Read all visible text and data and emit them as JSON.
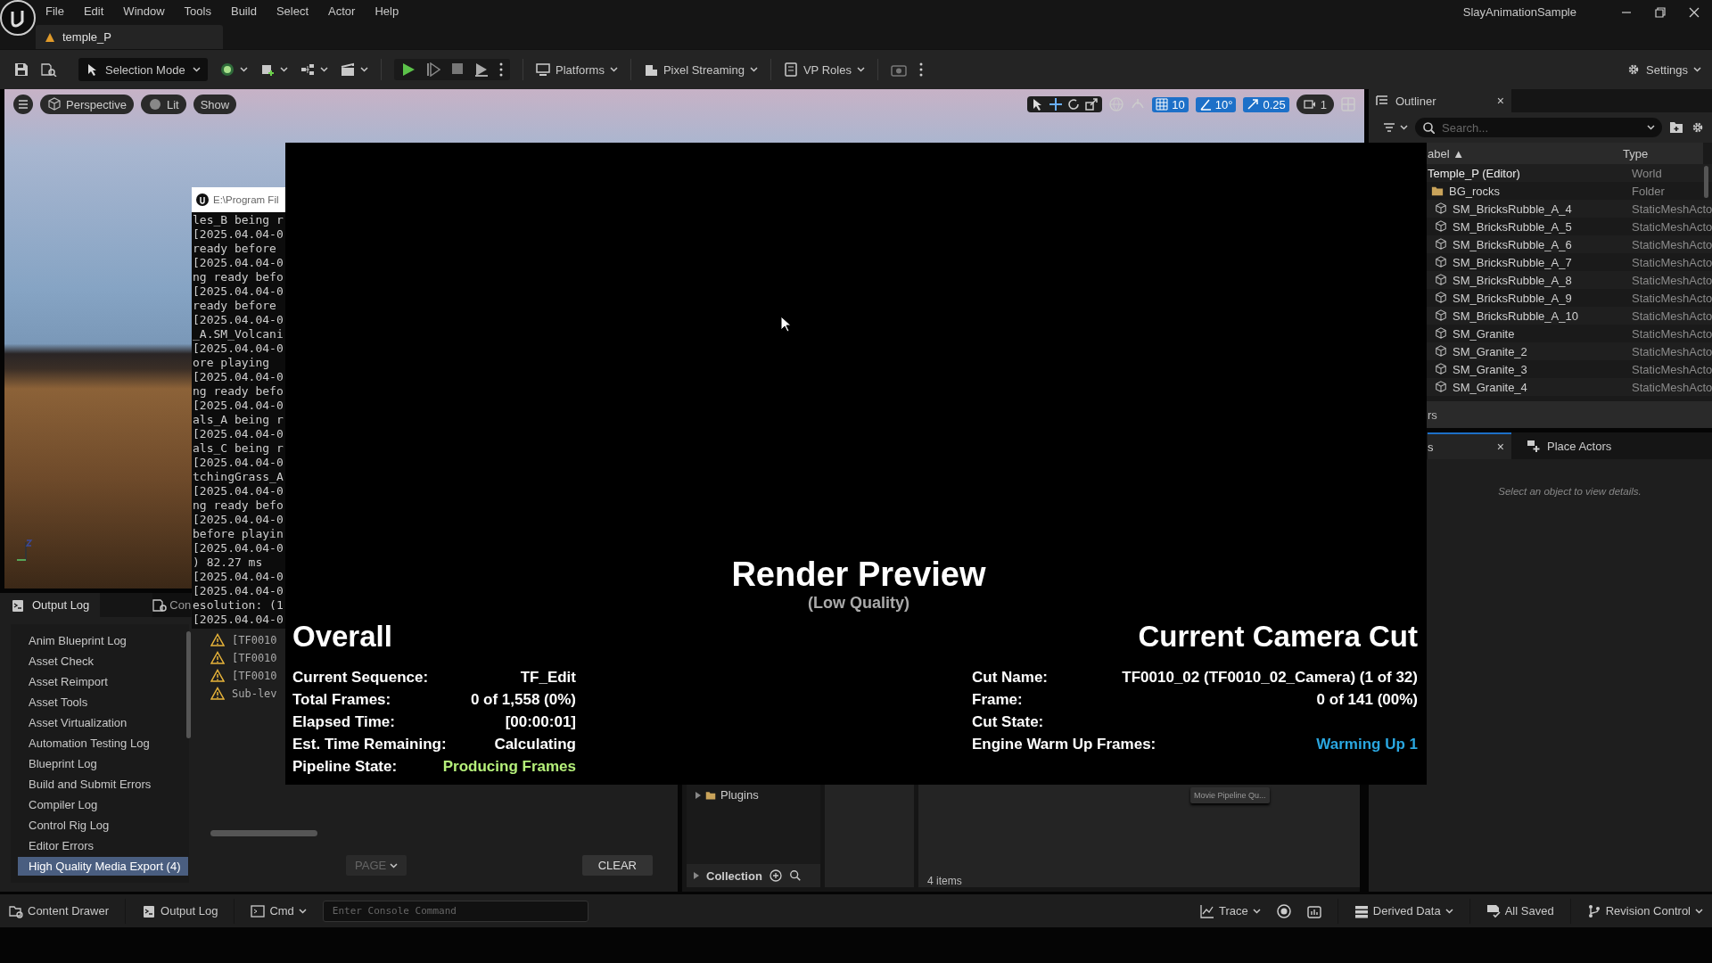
{
  "title_bar": {
    "menu": [
      "File",
      "Edit",
      "Window",
      "Tools",
      "Build",
      "Select",
      "Actor",
      "Help"
    ],
    "level_tab": "temple_P",
    "project": "SlayAnimationSample"
  },
  "toolbar": {
    "mode": "Selection Mode",
    "dropdowns": [
      "Platforms",
      "Pixel Streaming",
      "VP Roles"
    ],
    "settings": "Settings"
  },
  "viewport": {
    "view_buttons": [
      "Perspective",
      "Lit",
      "Show"
    ],
    "grid_snap": "10",
    "rotation_snap": "10°",
    "scale_snap": "0.25",
    "camera_speed": "1"
  },
  "console_window": {
    "title": "E:\\Program Fil",
    "lines": [
      "les_B being r",
      "[2025.04.04-0",
      "ready before",
      "[2025.04.04-0",
      "ng ready befo",
      "[2025.04.04-0",
      "ready before",
      "[2025.04.04-0",
      "_A.SM_Volcani",
      "[2025.04.04-0",
      "ore playing",
      "[2025.04.04-0",
      "ng ready befo",
      "[2025.04.04-0",
      "als_A being r",
      "[2025.04.04-0",
      "als_C being r",
      "[2025.04.04-0",
      "tchingGrass_A",
      "[2025.04.04-0",
      "ng ready befo",
      "[2025.04.04-0",
      "before playin",
      "[2025.04.04-0",
      ") 82.27 ms",
      "[2025.04.04-0",
      "[2025.04.04-0",
      "esolution: (1",
      "[2025.04.04-0"
    ]
  },
  "render_preview": {
    "title": "Render Preview",
    "subtitle": "(Low Quality)",
    "overall": {
      "heading": "Overall",
      "rows": [
        {
          "label": "Current Sequence:",
          "value": "TF_Edit"
        },
        {
          "label": "Total Frames:",
          "value": "0 of 1,558 (0%)"
        },
        {
          "label": "Elapsed Time:",
          "value": "[00:00:01]"
        },
        {
          "label": "Est. Time Remaining:",
          "value": "Calculating"
        },
        {
          "label": "Pipeline State:",
          "value": "Producing Frames",
          "color": "#b5f07a"
        }
      ]
    },
    "camera_cut": {
      "heading": "Current Camera Cut",
      "rows": [
        {
          "label": "Cut Name:",
          "value": "TF0010_02 (TF0010_02_Camera) (1 of 32)"
        },
        {
          "label": "Frame:",
          "value": "0 of 141 (00%)"
        },
        {
          "label": "Cut State:"
        },
        {
          "label": "Engine Warm Up Frames:",
          "value": "Warming Up 1",
          "color": "#2aa7e0"
        }
      ]
    }
  },
  "outliner": {
    "tab": "Outliner",
    "close": "×",
    "search_placeholder": "Search...",
    "columns": [
      "abel ▲",
      "Type"
    ],
    "tree": [
      {
        "label": "Temple_P (Editor)",
        "type": "World",
        "kind": "world",
        "children": [
          {
            "label": "BG_rocks",
            "type": "Folder",
            "kind": "folder",
            "children": [
              {
                "label": "SM_BricksRubble_A_4",
                "type": "StaticMeshActo",
                "kind": "mesh"
              },
              {
                "label": "SM_BricksRubble_A_5",
                "type": "StaticMeshActo",
                "kind": "mesh"
              },
              {
                "label": "SM_BricksRubble_A_6",
                "type": "StaticMeshActo",
                "kind": "mesh"
              },
              {
                "label": "SM_BricksRubble_A_7",
                "type": "StaticMeshActo",
                "kind": "mesh"
              },
              {
                "label": "SM_BricksRubble_A_8",
                "type": "StaticMeshActo",
                "kind": "mesh"
              },
              {
                "label": "SM_BricksRubble_A_9",
                "type": "StaticMeshActo",
                "kind": "mesh"
              },
              {
                "label": "SM_BricksRubble_A_10",
                "type": "StaticMeshActo",
                "kind": "mesh"
              },
              {
                "label": "SM_Granite",
                "type": "StaticMeshActo",
                "kind": "mesh"
              },
              {
                "label": "SM_Granite_2",
                "type": "StaticMeshActo",
                "kind": "mesh"
              },
              {
                "label": "SM_Granite_3",
                "type": "StaticMeshActo",
                "kind": "mesh"
              },
              {
                "label": "SM_Granite_4",
                "type": "StaticMeshActo",
                "kind": "mesh"
              }
            ]
          }
        ]
      }
    ],
    "footer": "rs"
  },
  "details": {
    "tabs": [
      {
        "label": "s",
        "selected": true
      },
      {
        "label": "Place Actors",
        "selected": false
      }
    ],
    "close": "×",
    "empty_message": "Select an object to view details."
  },
  "output_log": {
    "tabs": [
      {
        "label": "Output Log",
        "selected": true
      },
      {
        "label": "Con",
        "selected": false
      }
    ],
    "categories": [
      {
        "label": "Anim Blueprint Log",
        "selected": false
      },
      {
        "label": "Asset Check",
        "selected": false
      },
      {
        "label": "Asset Reimport",
        "selected": false
      },
      {
        "label": "Asset Tools",
        "selected": false
      },
      {
        "label": "Asset Virtualization",
        "selected": false
      },
      {
        "label": "Automation Testing Log",
        "selected": false
      },
      {
        "label": "Blueprint Log",
        "selected": false
      },
      {
        "label": "Build and Submit Errors",
        "selected": false
      },
      {
        "label": "Compiler Log",
        "selected": false
      },
      {
        "label": "Control Rig Log",
        "selected": false
      },
      {
        "label": "Editor Errors",
        "selected": false
      },
      {
        "label": "High Quality Media Export (4)",
        "selected": true
      }
    ],
    "messages": [
      "[TF0010",
      "[TF0010",
      "[TF0010",
      "Sub-lev"
    ],
    "page_button": "PAGE",
    "clear_button": "CLEAR"
  },
  "content_browser": {
    "folder": "Plugins",
    "collection": "Collection",
    "asset": "Movie Pipeline Qu...",
    "item_count": "4 items"
  },
  "status_bar": {
    "content_drawer": "Content Drawer",
    "output_log": "Output Log",
    "cmd": "Cmd",
    "console_placeholder": "Enter Console Command",
    "trace": "Trace",
    "derived_data": "Derived Data",
    "saved": "All Saved",
    "revision_control": "Revision Control"
  }
}
